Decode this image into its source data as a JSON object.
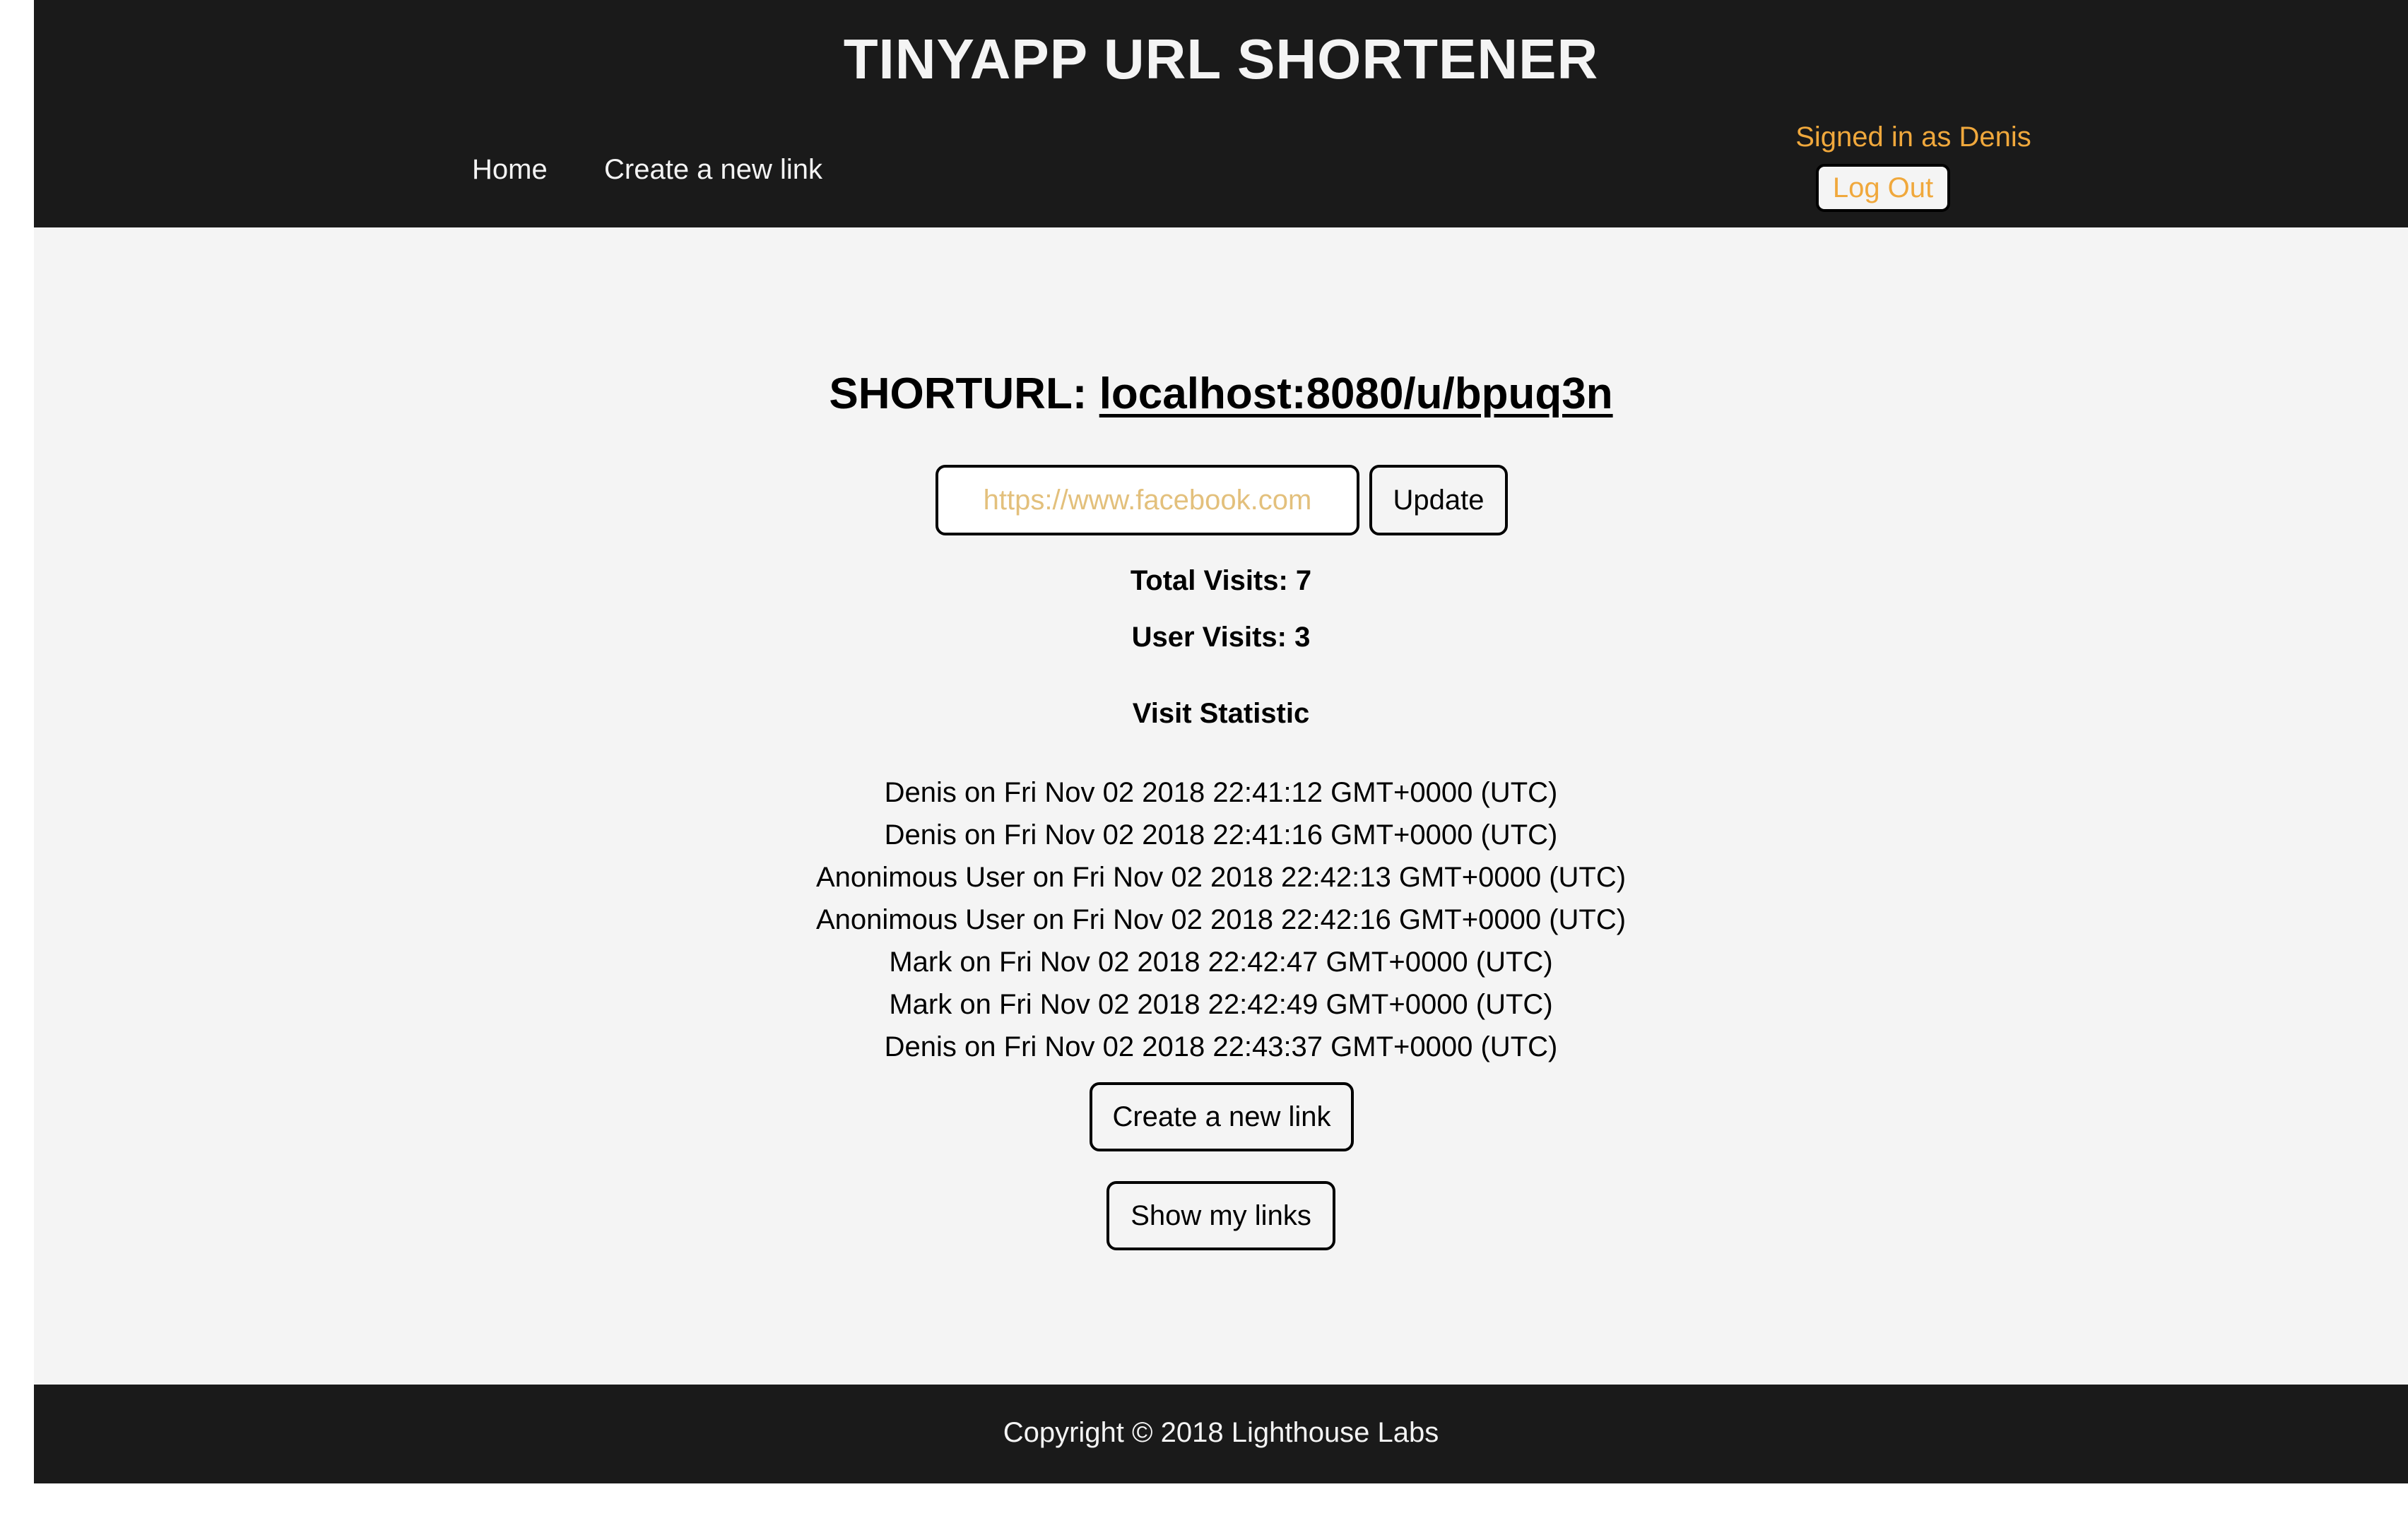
{
  "header": {
    "title": "TINYAPP URL SHORTENER",
    "nav": {
      "home": "Home",
      "create": "Create a new link"
    },
    "user": {
      "signed_in_text": "Signed in as Denis",
      "logout_label": "Log Out"
    }
  },
  "main": {
    "shorturl_prefix": "SHORTURL:",
    "shorturl_link": "localhost:8080/u/bpuq3n",
    "long_url_placeholder": "https://www.facebook.com",
    "update_label": "Update",
    "total_visits": "Total Visits: 7",
    "user_visits": "User Visits: 3",
    "visit_statistic_heading": "Visit Statistic",
    "visits": [
      "Denis on Fri Nov 02 2018 22:41:12 GMT+0000 (UTC)",
      "Denis on Fri Nov 02 2018 22:41:16 GMT+0000 (UTC)",
      "Anonimous User on Fri Nov 02 2018 22:42:13 GMT+0000 (UTC)",
      "Anonimous User on Fri Nov 02 2018 22:42:16 GMT+0000 (UTC)",
      "Mark on Fri Nov 02 2018 22:42:47 GMT+0000 (UTC)",
      "Mark on Fri Nov 02 2018 22:42:49 GMT+0000 (UTC)",
      "Denis on Fri Nov 02 2018 22:43:37 GMT+0000 (UTC)"
    ],
    "create_label": "Create a new link",
    "show_links_label": "Show my links"
  },
  "footer": {
    "copyright": "Copyright © 2018 Lighthouse Labs"
  },
  "colors": {
    "header_bg": "#1a1a1a",
    "page_bg": "#f4f4f4",
    "accent": "#f0a83c",
    "placeholder": "#e3c07c"
  }
}
